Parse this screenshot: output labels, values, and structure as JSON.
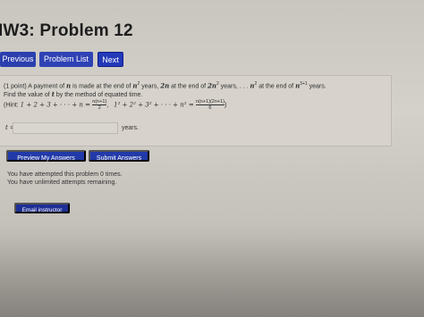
{
  "header": {
    "title": "IW3: Problem 12"
  },
  "nav": {
    "previous_label": "Previous",
    "problem_list_label": "Problem List",
    "next_label": "Next"
  },
  "problem": {
    "line1_a": "(1 point) A payment of ",
    "line1_n": "n",
    "line1_b": " is made at the end of ",
    "line1_n2": "n",
    "line1_sup2": "2",
    "line1_c": " years, ",
    "line1_2n": "2n",
    "line1_d": " at the end of ",
    "line1_2n2": "2n",
    "line1_sup2b": "2",
    "line1_e": " years, . . . ",
    "line1_nn": "n",
    "line1_sup2c": "2",
    "line1_f": " at the end of ",
    "line1_nn1": "n",
    "line1_sup3": "3+1",
    "line1_g": " years.",
    "line2_a": "Find the value of ",
    "line2_t": "t",
    "line2_b": " by the method of equated time.",
    "hint_a": "(Hint: ",
    "hint_sum1": "1 + 2 + 3 + · · · + n = ",
    "hint_frac1_num": "n(n+1)",
    "hint_frac1_den": "2",
    "hint_sep": ",",
    "hint_sum2": "1² + 2² + 3² + · · · + n² = ",
    "hint_frac2_num": "n(n+1)(2n+1)",
    "hint_frac2_den": "6",
    "hint_end": ")"
  },
  "answer": {
    "label": "t =",
    "value": "",
    "units": "years."
  },
  "actions": {
    "preview_label": "Preview My Answers",
    "submit_label": "Submit Answers"
  },
  "messages": {
    "attempted": "You have attempted this problem 0 times.",
    "unlimited": "You have unlimited attempts remaining."
  },
  "email": {
    "label": "Email instructor"
  }
}
